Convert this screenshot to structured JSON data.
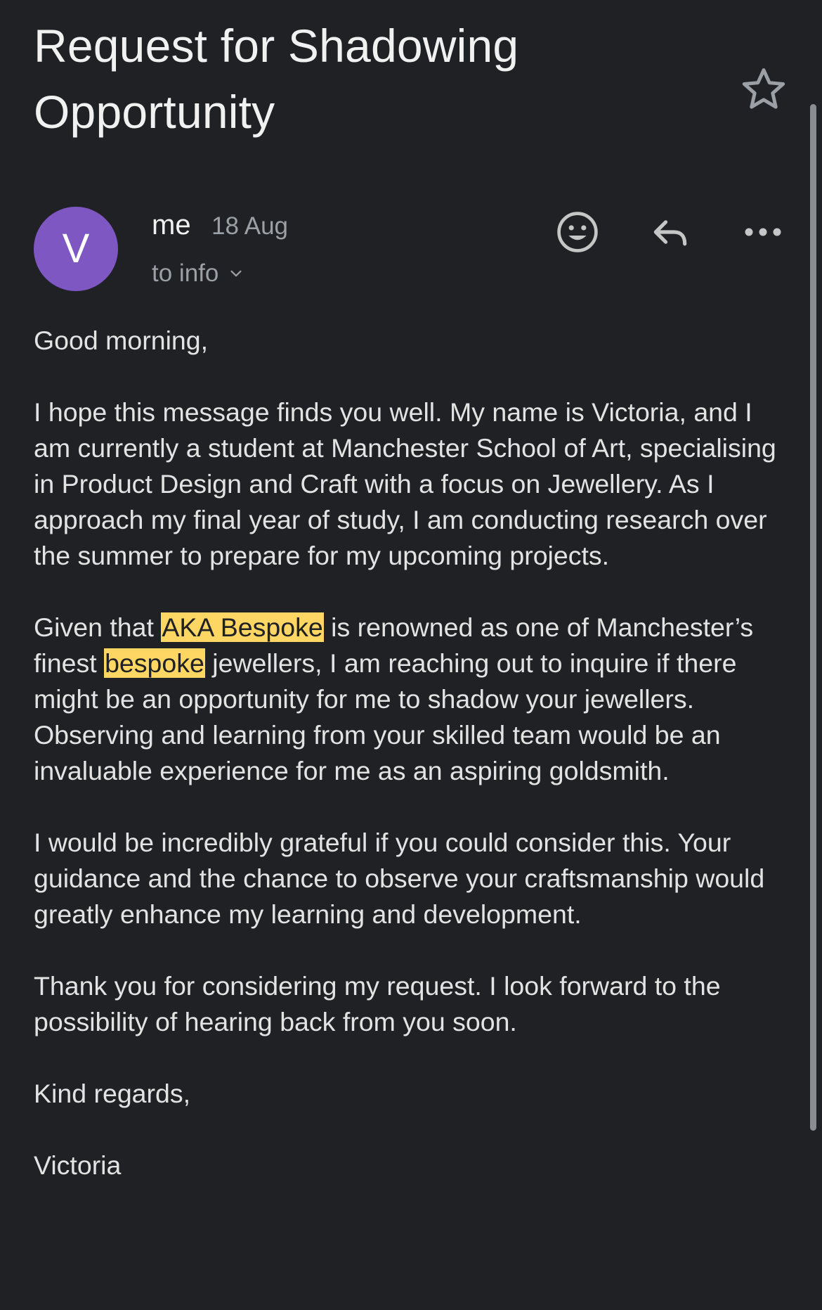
{
  "email": {
    "subject": "Request for Shadowing Opportunity",
    "sender": "me",
    "date": "18 Aug",
    "recipient": "to info",
    "avatar_initial": "V",
    "avatar_color": "#7e57c2"
  },
  "icons": {
    "star": "star-outline-icon",
    "emoji": "add-reaction-icon",
    "reply": "reply-icon",
    "more": "more-options-icon",
    "expand": "chevron-down-icon"
  },
  "highlight_color": "#fdd663",
  "body": {
    "greeting": "Good morning,",
    "p1": "I hope this message finds you well. My name is Victoria, and I am currently a student at Manchester School of Art, specialising in Product Design and Craft with a focus on Jewellery. As I approach my final year of study, I am conducting research over the summer to prepare for my upcoming projects.",
    "p2_a": "Given that ",
    "p2_hl1": "AKA Bespoke",
    "p2_b": " is renowned as one of Manchester’s finest ",
    "p2_hl2": "bespoke",
    "p2_c": " jewellers, I am reaching out to inquire if there might be an opportunity for me to shadow your jewellers. Observing and learning from your skilled team would be an invaluable experience for me as an aspiring goldsmith.",
    "p3": "I would be incredibly grateful if you could consider this. Your guidance and the chance to observe your craftsmanship would greatly enhance my learning and development.",
    "p4": "Thank you for considering my request. I look forward to the possibility of hearing back from you soon.",
    "signoff": "Kind regards,",
    "signature": "Victoria"
  }
}
